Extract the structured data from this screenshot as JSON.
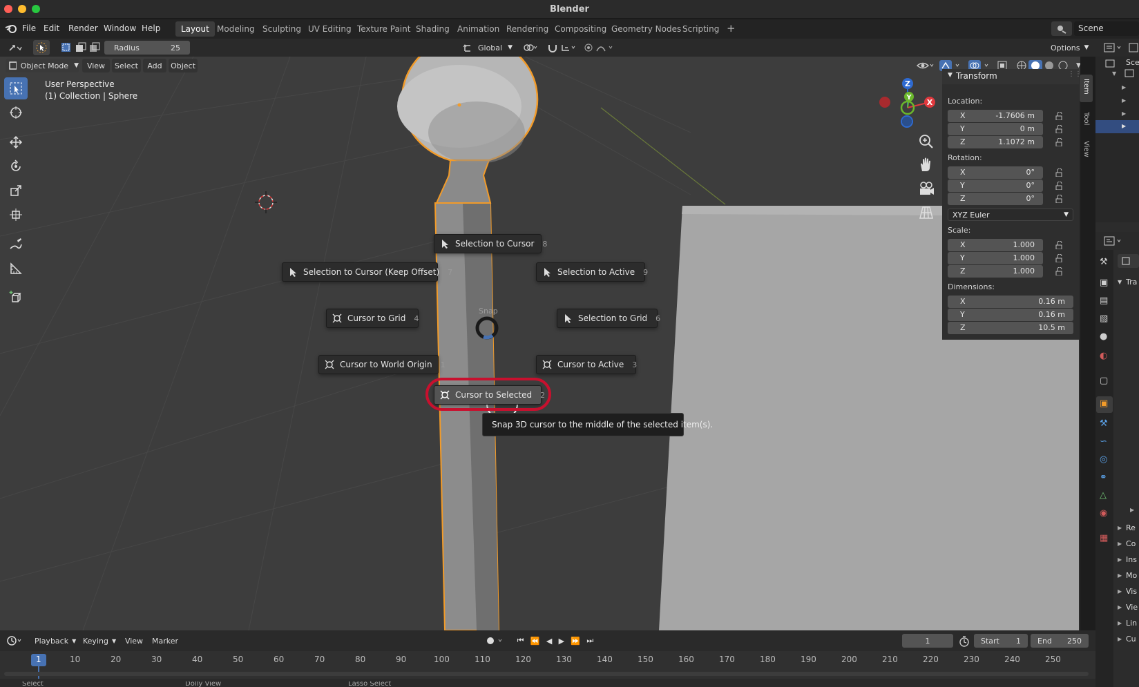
{
  "window": {
    "title": "Blender",
    "close_color": "#ff5f57",
    "minimize_color": "#febc2e",
    "zoom_color": "#28c840"
  },
  "menu": {
    "items": [
      "File",
      "Edit",
      "Render",
      "Window",
      "Help"
    ]
  },
  "workspaces": {
    "tabs": [
      "Layout",
      "Modeling",
      "Sculpting",
      "UV Editing",
      "Texture Paint",
      "Shading",
      "Animation",
      "Rendering",
      "Compositing",
      "Geometry Nodes",
      "Scripting"
    ],
    "active": "Layout",
    "add": "+"
  },
  "scene": {
    "label": "Scene"
  },
  "toolheader": {
    "radius_label": "Radius",
    "radius_value": "25",
    "orientation": "Global",
    "options": "Options"
  },
  "viewheader": {
    "mode": "Object Mode",
    "items": [
      "View",
      "Select",
      "Add",
      "Object"
    ]
  },
  "viewport": {
    "perspective": "User Perspective",
    "collection": "(1) Collection | Sphere",
    "accent": "#4772b3",
    "selection_outline": "#f29b29"
  },
  "gizmo": {
    "z": "Z",
    "y": "Y",
    "x": "X"
  },
  "pie": {
    "title": "Snap",
    "items": [
      {
        "label": "Selection to Cursor",
        "key": "8",
        "icon": "arrow"
      },
      {
        "label": "Selection to Cursor (Keep Offset)",
        "key": "7",
        "icon": "arrow"
      },
      {
        "label": "Selection to Active",
        "key": "9",
        "icon": "arrow"
      },
      {
        "label": "Cursor to Grid",
        "key": "4",
        "icon": "cursor"
      },
      {
        "label": "Selection to Grid",
        "key": "6",
        "icon": "arrow"
      },
      {
        "label": "Cursor to World Origin",
        "key": "1",
        "icon": "cursor"
      },
      {
        "label": "Cursor to Active",
        "key": "3",
        "icon": "cursor"
      },
      {
        "label": "Cursor to Selected",
        "key": "2",
        "icon": "cursor"
      }
    ],
    "tooltip": "Snap 3D cursor to the middle of the selected item(s).",
    "highlight_color": "#c8102e"
  },
  "npanel": {
    "tabs": [
      "Item",
      "Tool",
      "View"
    ],
    "title": "Transform",
    "location_label": "Location:",
    "location": [
      {
        "axis": "X",
        "value": "-1.7606 m"
      },
      {
        "axis": "Y",
        "value": "0 m"
      },
      {
        "axis": "Z",
        "value": "1.1072 m"
      }
    ],
    "rotation_label": "Rotation:",
    "rotation": [
      {
        "axis": "X",
        "value": "0°"
      },
      {
        "axis": "Y",
        "value": "0°"
      },
      {
        "axis": "Z",
        "value": "0°"
      }
    ],
    "rotation_mode": "XYZ Euler",
    "scale_label": "Scale:",
    "scale": [
      {
        "axis": "X",
        "value": "1.000"
      },
      {
        "axis": "Y",
        "value": "1.000"
      },
      {
        "axis": "Z",
        "value": "1.000"
      }
    ],
    "dimensions_label": "Dimensions:",
    "dimensions": [
      {
        "axis": "X",
        "value": "0.16 m"
      },
      {
        "axis": "Y",
        "value": "0.16 m"
      },
      {
        "axis": "Z",
        "value": "10.5 m"
      }
    ]
  },
  "rightside": {
    "outliner_label": "Sce",
    "props_rows": [
      "Tra",
      "Re",
      "Co",
      "Ins",
      "Mo",
      "Vis",
      "Vie",
      "Lin",
      "Cu"
    ]
  },
  "timeline": {
    "menus": [
      "Playback",
      "Keying",
      "View",
      "Marker"
    ],
    "current_frame": "1",
    "start_label": "Start",
    "start": "1",
    "end_label": "End",
    "end": "250",
    "ticks": [
      "1",
      "10",
      "20",
      "30",
      "40",
      "50",
      "60",
      "70",
      "80",
      "90",
      "100",
      "110",
      "120",
      "130",
      "140",
      "150",
      "160",
      "170",
      "180",
      "190",
      "200",
      "210",
      "220",
      "230",
      "240",
      "250"
    ]
  },
  "statusbar": {
    "items": [
      "Select",
      "Dolly View",
      "Lasso Select"
    ]
  }
}
